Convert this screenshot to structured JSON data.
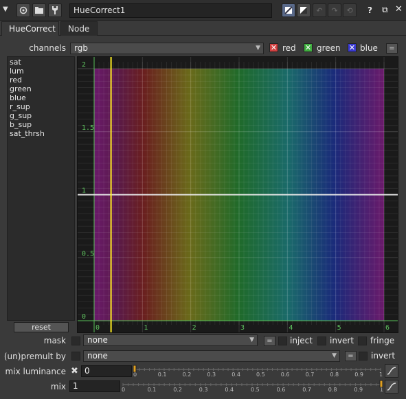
{
  "node": {
    "name": "HueCorrect1"
  },
  "title_icons": [
    "collapse-arrow-icon",
    "node-icon",
    "folder-icon",
    "tools-icon"
  ],
  "tabs": [
    {
      "label": "HueCorrect"
    },
    {
      "label": "Node"
    }
  ],
  "channels": {
    "label": "channels",
    "value": "rgb",
    "toggles": [
      {
        "label": "red",
        "checked": true,
        "color": "#d04040"
      },
      {
        "label": "green",
        "checked": true,
        "color": "#3fae3f"
      },
      {
        "label": "blue",
        "checked": true,
        "color": "#3a3ad0"
      }
    ],
    "equals_label": "="
  },
  "curves": [
    "sat",
    "lum",
    "red",
    "green",
    "blue",
    "r_sup",
    "g_sup",
    "b_sup",
    "sat_thrsh"
  ],
  "reset_label": "reset",
  "graph": {
    "x_ticks": [
      "0",
      "1",
      "2",
      "3",
      "4",
      "5",
      "6"
    ],
    "y_ticks": [
      "0",
      "0.5",
      "1",
      "1.5",
      "2"
    ],
    "curve_value": 1,
    "playhead_x": 0.35
  },
  "mask": {
    "label": "mask",
    "value": "none",
    "equals_label": "=",
    "options": [
      {
        "label": "inject"
      },
      {
        "label": "invert"
      },
      {
        "label": "fringe"
      }
    ]
  },
  "premult": {
    "label": "(un)premult by",
    "value": "none",
    "equals_label": "=",
    "invert_label": "invert"
  },
  "mix_luminance": {
    "label": "mix luminance",
    "value": "0",
    "ticks": [
      "0",
      "0.1",
      "0.2",
      "0.3",
      "0.4",
      "0.5",
      "0.6",
      "0.7",
      "0.8",
      "0.9",
      "1"
    ],
    "slider_value": 0
  },
  "mix": {
    "label": "mix",
    "value": "1",
    "ticks": [
      "0",
      "0.1",
      "0.2",
      "0.3",
      "0.4",
      "0.5",
      "0.6",
      "0.7",
      "0.8",
      "0.9",
      "1"
    ],
    "slider_value": 1
  },
  "window_controls": {
    "help": "?"
  }
}
